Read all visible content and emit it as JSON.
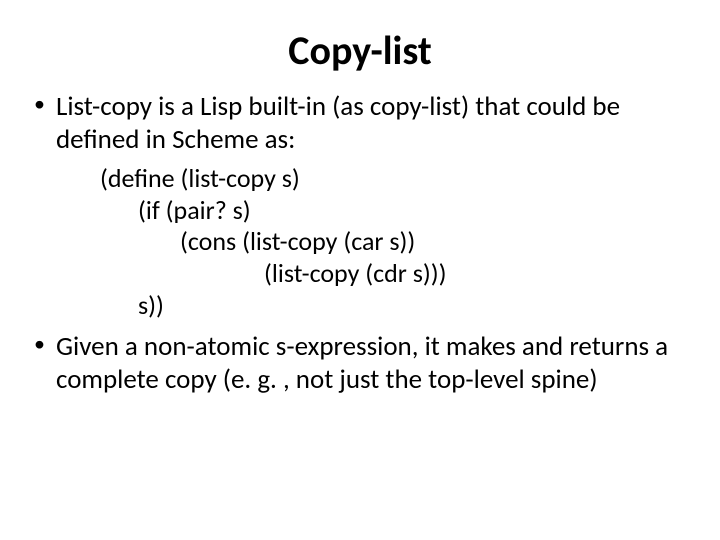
{
  "title": "Copy-list",
  "bullets": [
    "List-copy is a Lisp built-in (as copy-list) that could be defined in Scheme as:",
    "Given a non-atomic s-expression, it makes and returns a complete copy (e. g. , not just the top-level spine)"
  ],
  "code": {
    "l0": "(define (list-copy s)",
    "l1": "(if (pair? s)",
    "l2": "(cons (list-copy (car s))",
    "l3": "(list-copy (cdr s)))",
    "l4": "s))"
  }
}
